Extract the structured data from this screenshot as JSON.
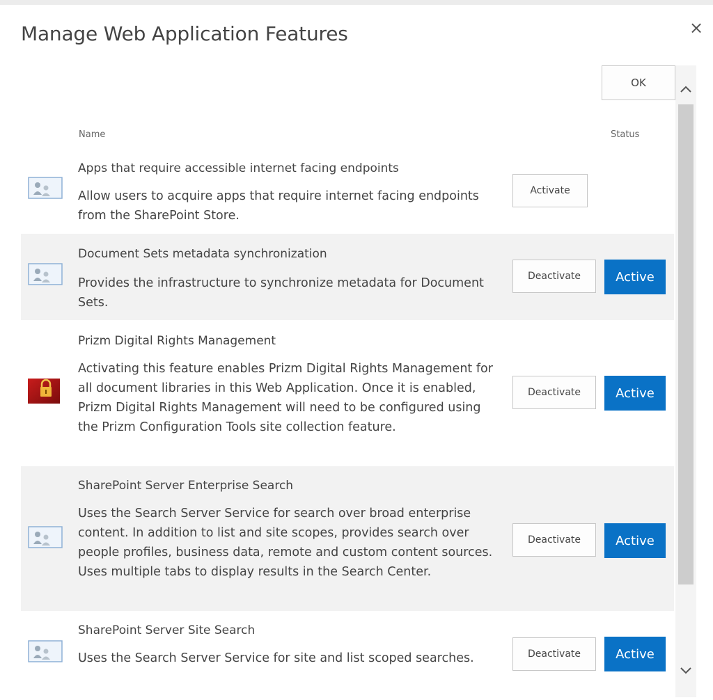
{
  "dialog": {
    "title": "Manage Web Application Features",
    "close_glyph": "×"
  },
  "toolbar": {
    "ok_label": "OK"
  },
  "columns": {
    "name": "Name",
    "status": "Status"
  },
  "features": [
    {
      "title": "Apps that require accessible internet facing endpoints",
      "description": "Allow users to acquire apps that require internet facing endpoints from the SharePoint Store.",
      "action_label": "Activate",
      "status": "",
      "icon": "feature-icon"
    },
    {
      "title": "Document Sets metadata synchronization",
      "description": "Provides the infrastructure to synchronize metadata for Document Sets.",
      "action_label": "Deactivate",
      "status": "Active",
      "icon": "feature-icon"
    },
    {
      "title": "Prizm Digital Rights Management",
      "description": "Activating this feature enables Prizm Digital Rights Management for all document libraries in this Web Application. Once it is enabled, Prizm Digital Rights Management will need to be configured using the Prizm Configuration Tools site collection feature.",
      "action_label": "Deactivate",
      "status": "Active",
      "icon": "lock-icon"
    },
    {
      "title": "SharePoint Server Enterprise Search",
      "description": "Uses the Search Server Service for search over broad enterprise content. In addition to list and site scopes, provides search over people profiles, business data, remote and custom content sources. Uses multiple tabs to display results in the Search Center.",
      "action_label": "Deactivate",
      "status": "Active",
      "icon": "feature-icon"
    },
    {
      "title": "SharePoint Server Site Search",
      "description": "Uses the Search Server Service for site and list scoped searches.",
      "action_label": "Deactivate",
      "status": "Active",
      "icon": "feature-icon"
    }
  ],
  "colors": {
    "accent": "#0a72c6",
    "row_shade": "#f2f2f2"
  },
  "scrollbar": {
    "up_glyph": "⌃",
    "down_glyph": "⌄"
  }
}
